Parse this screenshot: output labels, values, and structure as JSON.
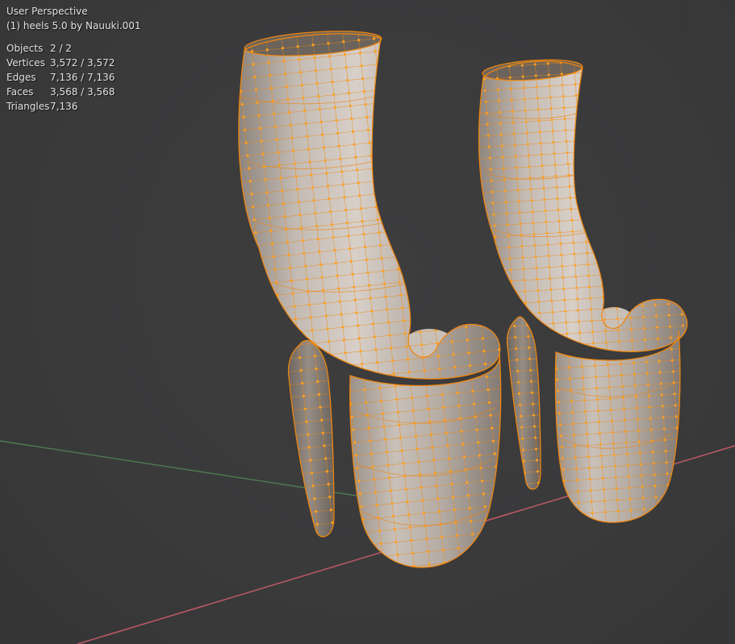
{
  "viewport": {
    "perspective_label": "User Perspective",
    "collection_label": "(1) heels 5.0 by Nauuki.001",
    "stats": [
      {
        "label": "Objects",
        "value": "2 / 2"
      },
      {
        "label": "Vertices",
        "value": "3,572 / 3,572"
      },
      {
        "label": "Edges",
        "value": "7,136 / 7,136"
      },
      {
        "label": "Faces",
        "value": "3,568 / 3,568"
      },
      {
        "label": "Triangles",
        "value": "7,136"
      }
    ],
    "colors": {
      "background": "#3a3a3b",
      "wireframe_edge": "#ef860e",
      "wireframe_vertex": "#ffa01e",
      "axis_x": "#b95862",
      "axis_y": "#4e7a4e",
      "overlay_text": "#e2e2e2"
    }
  }
}
